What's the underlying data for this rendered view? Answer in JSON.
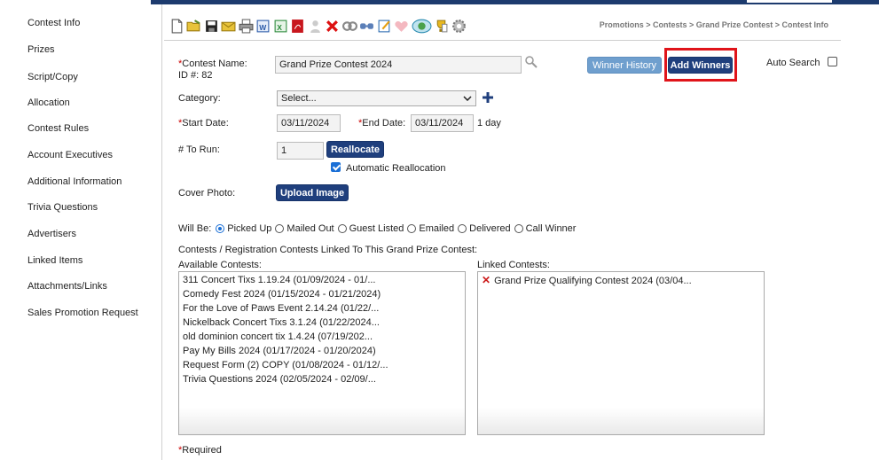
{
  "sidebar": {
    "items": [
      {
        "label": "Contest Info",
        "active": true
      },
      {
        "label": "Prizes"
      },
      {
        "label": "Script/Copy"
      },
      {
        "label": "Allocation"
      },
      {
        "label": "Contest Rules"
      },
      {
        "label": "Account Executives"
      },
      {
        "label": "Additional Information"
      },
      {
        "label": "Trivia Questions"
      },
      {
        "label": "Advertisers"
      },
      {
        "label": "Linked Items"
      },
      {
        "label": "Attachments/Links"
      },
      {
        "label": "Sales Promotion Request"
      }
    ]
  },
  "toolbar": {
    "icons": [
      "new-document",
      "open-folder",
      "save",
      "email",
      "print",
      "export-word",
      "export-excel",
      "export-pdf",
      "user",
      "delete",
      "copy",
      "link",
      "notes",
      "heart",
      "refresh",
      "trophy",
      "settings"
    ]
  },
  "breadcrumb": "Promotions > Contests > Grand Prize Contest > Contest Info",
  "form": {
    "contest_name_label": "Contest Name:",
    "contest_name_value": "Grand Prize Contest 2024",
    "id_label": "ID #: 82",
    "winner_history_label": "Winner History",
    "add_winners_label": "Add Winners",
    "auto_search_label": "Auto Search",
    "auto_search_checked": false,
    "category_label": "Category:",
    "category_value": "Select...",
    "start_date_label": "Start Date:",
    "start_date_value": "03/11/2024",
    "end_date_label": "End Date:",
    "end_date_value": "03/11/2024",
    "duration": "1 day",
    "to_run_label": "# To Run:",
    "to_run_value": "1",
    "reallocate_label": "Reallocate",
    "auto_realloc_label": "Automatic Reallocation",
    "auto_realloc_checked": true,
    "cover_photo_label": "Cover Photo:",
    "upload_image_label": "Upload Image",
    "will_be_label": "Will Be:",
    "will_be_options": [
      "Picked Up",
      "Mailed Out",
      "Guest Listed",
      "Emailed",
      "Delivered",
      "Call Winner"
    ],
    "will_be_selected": "Picked Up",
    "linked_header": "Contests / Registration Contests Linked To This Grand Prize Contest:",
    "available_label": "Available Contests:",
    "linked_label": "Linked Contests:",
    "available_contests": [
      "311 Concert Tixs 1.19.24 (01/09/2024 - 01/...",
      "Comedy Fest 2024 (01/15/2024 - 01/21/2024)",
      "For the Love of Paws Event 2.14.24 (01/22/...",
      "Nickelback Concert Tixs 3.1.24 (01/22/2024...",
      "old dominion concert tix 1.4.24 (07/19/202...",
      "Pay My Bills 2024 (01/17/2024 - 01/20/2024)",
      "Request Form (2) COPY (01/08/2024 - 01/12/...",
      "Trivia Questions 2024 (02/05/2024 - 02/09/..."
    ],
    "linked_contests": [
      "Grand Prize Qualifying Contest 2024 (03/04..."
    ],
    "required_note": "*Required",
    "required_marker": "*"
  }
}
